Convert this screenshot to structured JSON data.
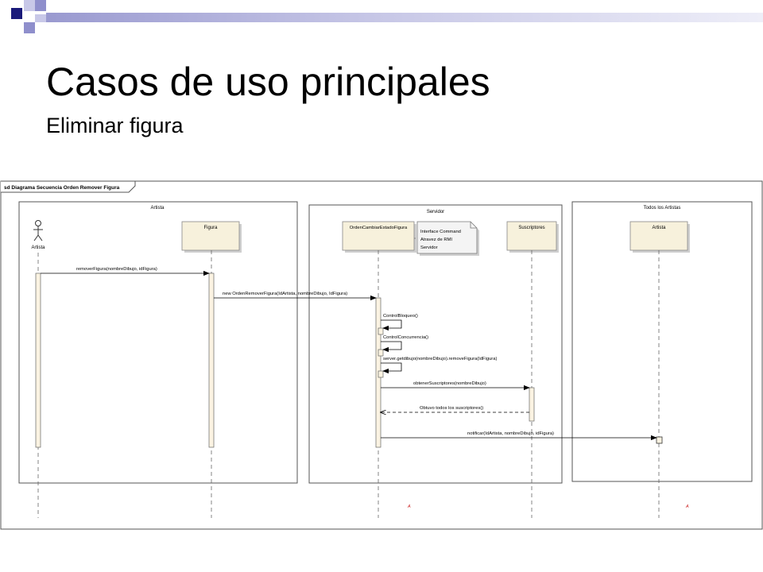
{
  "slide": {
    "title": "Casos de uso principales",
    "subtitle": "Eliminar figura",
    "accent_colors": {
      "dark": "#1a1a7a",
      "mid": "#8f8fcc",
      "light": "#c8c8e8",
      "bar": "#b4b4dc"
    }
  },
  "diagram": {
    "frame_label": "sd Diagrama Secuencia Orden Remover Figura",
    "boundaries": {
      "artista": "Artista",
      "servidor": "Servidor",
      "todos": "Todos los Artistas"
    },
    "actor": {
      "name": "Artista"
    },
    "lifelines": {
      "figura": "Figura",
      "orden": "OrdenCambiarEstadoFigura",
      "suscriptores": "Suscriptores",
      "artista2": "Artista"
    },
    "note": [
      "Interface Command",
      "Atravez de RMI",
      "Servidor"
    ],
    "messages": {
      "m1": "removerFigura(nombreDibujo, idFigura)",
      "m2": "new OrdenRemoverFigura(IdArtista, nombreDibujo, IdFigura)",
      "m3": "ControlBloqueo()",
      "m4": "ControlConcurrencia()",
      "m5": "server.getdibujo(nombreDibujo).removeFigura(IdFigura)",
      "m6": "obtenerSuscriptores(nombreDibujo)",
      "m7": "Obtuvo todos los suscriptores()",
      "m8": "notificar(IdArtista, nombreDibujo, idFigura)"
    },
    "marks": {
      "left": "A",
      "right": "A"
    },
    "colors": {
      "lifeline_box": "#f7f1dc",
      "activation": "#fbf3e2",
      "note": "#f4f4f4",
      "mark": "#cc2222"
    }
  }
}
